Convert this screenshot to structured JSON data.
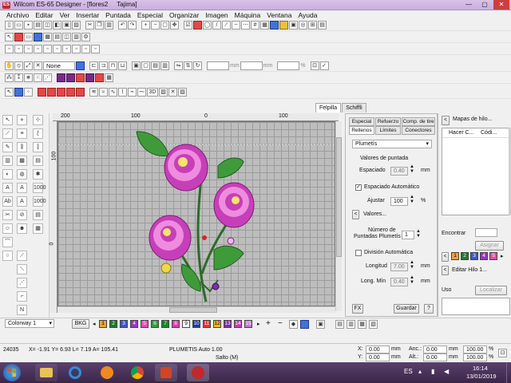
{
  "window": {
    "title": "Wilcom ES-65 Designer - [flores2     Tajima]",
    "app_icon_text": "ES",
    "min": "—",
    "max": "▢",
    "close": "✕"
  },
  "menu": [
    "Archivo",
    "Editar",
    "Ver",
    "Insertar",
    "Puntada",
    "Especial",
    "Organizar",
    "Imagen",
    "Máquina",
    "Ventana",
    "Ayuda"
  ],
  "toolbar": {
    "none_dropdown": "None",
    "mm1": "mm",
    "mm2": "mm",
    "pct": "%",
    "threed": "3D"
  },
  "ruler": {
    "top_ticks": [
      "200",
      "100",
      "0",
      "100"
    ],
    "left_ticks": [
      "100",
      "0"
    ]
  },
  "top_tabs": [
    {
      "label": "Felpilla",
      "active": true
    },
    {
      "label": "Schiffli",
      "active": false
    }
  ],
  "panel": {
    "tabs_row1": [
      "Especial",
      "Refuerzo",
      "Comp. de tire"
    ],
    "tabs_row2": [
      "Rellenos",
      "Límites",
      "Conectores"
    ],
    "fill_type": "Plumetís",
    "spacing_title": "Valores de puntada",
    "spacing_label": "Espaciado",
    "spacing_value": "0.40",
    "unit_mm": "mm",
    "auto_spacing_label": "Espaciado Automático",
    "auto_spacing_checked": true,
    "adjust_label": "Ajustar",
    "adjust_value": "100",
    "adjust_unit": "%",
    "values_button": "Valores...",
    "count_label_1": "Número de",
    "count_label_2": "Puntadas Plumetís",
    "count_value": "1",
    "auto_split_label": "División Automática",
    "auto_split_checked": false,
    "length_label": "Longitud",
    "length_value": "7.00",
    "minlen_label": "Long. Mín",
    "minlen_value": "0.40",
    "fx_button": "FX",
    "save_button": "Guardar",
    "help_button": "?"
  },
  "right_panel": {
    "maps_button": "<",
    "maps_title": "Mapas de hilo...",
    "col1": "Hacer C...",
    "col2": "Códi...",
    "find_label": "Encontrar",
    "assign_button": "Asignar",
    "mini_swatches": [
      "1",
      "2",
      "3",
      "4",
      "5"
    ],
    "edit_thread": "Editar Hilo 1...",
    "use_label": "Uso",
    "locate_button": "Localizar"
  },
  "colorbar": {
    "colorway": "Colorway 1",
    "bkg": "BKG",
    "swatches": [
      {
        "n": "1",
        "color": "#f0a23c"
      },
      {
        "n": "2",
        "color": "#1d7a2e"
      },
      {
        "n": "3",
        "color": "#3d57c9"
      },
      {
        "n": "4",
        "color": "#9b34c4"
      },
      {
        "n": "5",
        "color": "#e04bb0"
      },
      {
        "n": "6",
        "color": "#2f9e44"
      },
      {
        "n": "7",
        "color": "#148a2a"
      },
      {
        "n": "8",
        "color": "#d93db0"
      },
      {
        "n": "9",
        "color": "#ffffff"
      },
      {
        "n": "10",
        "color": "#1e3aa8"
      },
      {
        "n": "11",
        "color": "#e23838"
      },
      {
        "n": "12",
        "color": "#f2b52c"
      },
      {
        "n": "13",
        "color": "#7d2ea8"
      },
      {
        "n": "14",
        "color": "#c53fb3"
      },
      {
        "n": "15",
        "color": "#c07ad0"
      }
    ]
  },
  "status": {
    "stitches": "24035",
    "xy": "X= -1.91 Y= 6.93 L= 7.19 A= 105.41",
    "fill": "PLUMETIS Auto  1.00",
    "jump": "Salto (M)",
    "x_label": "X:",
    "x_val": "0.00",
    "y_label": "Y:",
    "y_val": "0.00",
    "mm": "mm",
    "anc_label": "Anc.:",
    "anc_val": "0.00",
    "alt_label": "Alt.:",
    "alt_val": "0.00",
    "pct1": "100.00",
    "pct2": "100.00",
    "pct": "%"
  },
  "taskbar": {
    "lang": "ES",
    "time": "16:14",
    "date": "13/01/2019"
  }
}
